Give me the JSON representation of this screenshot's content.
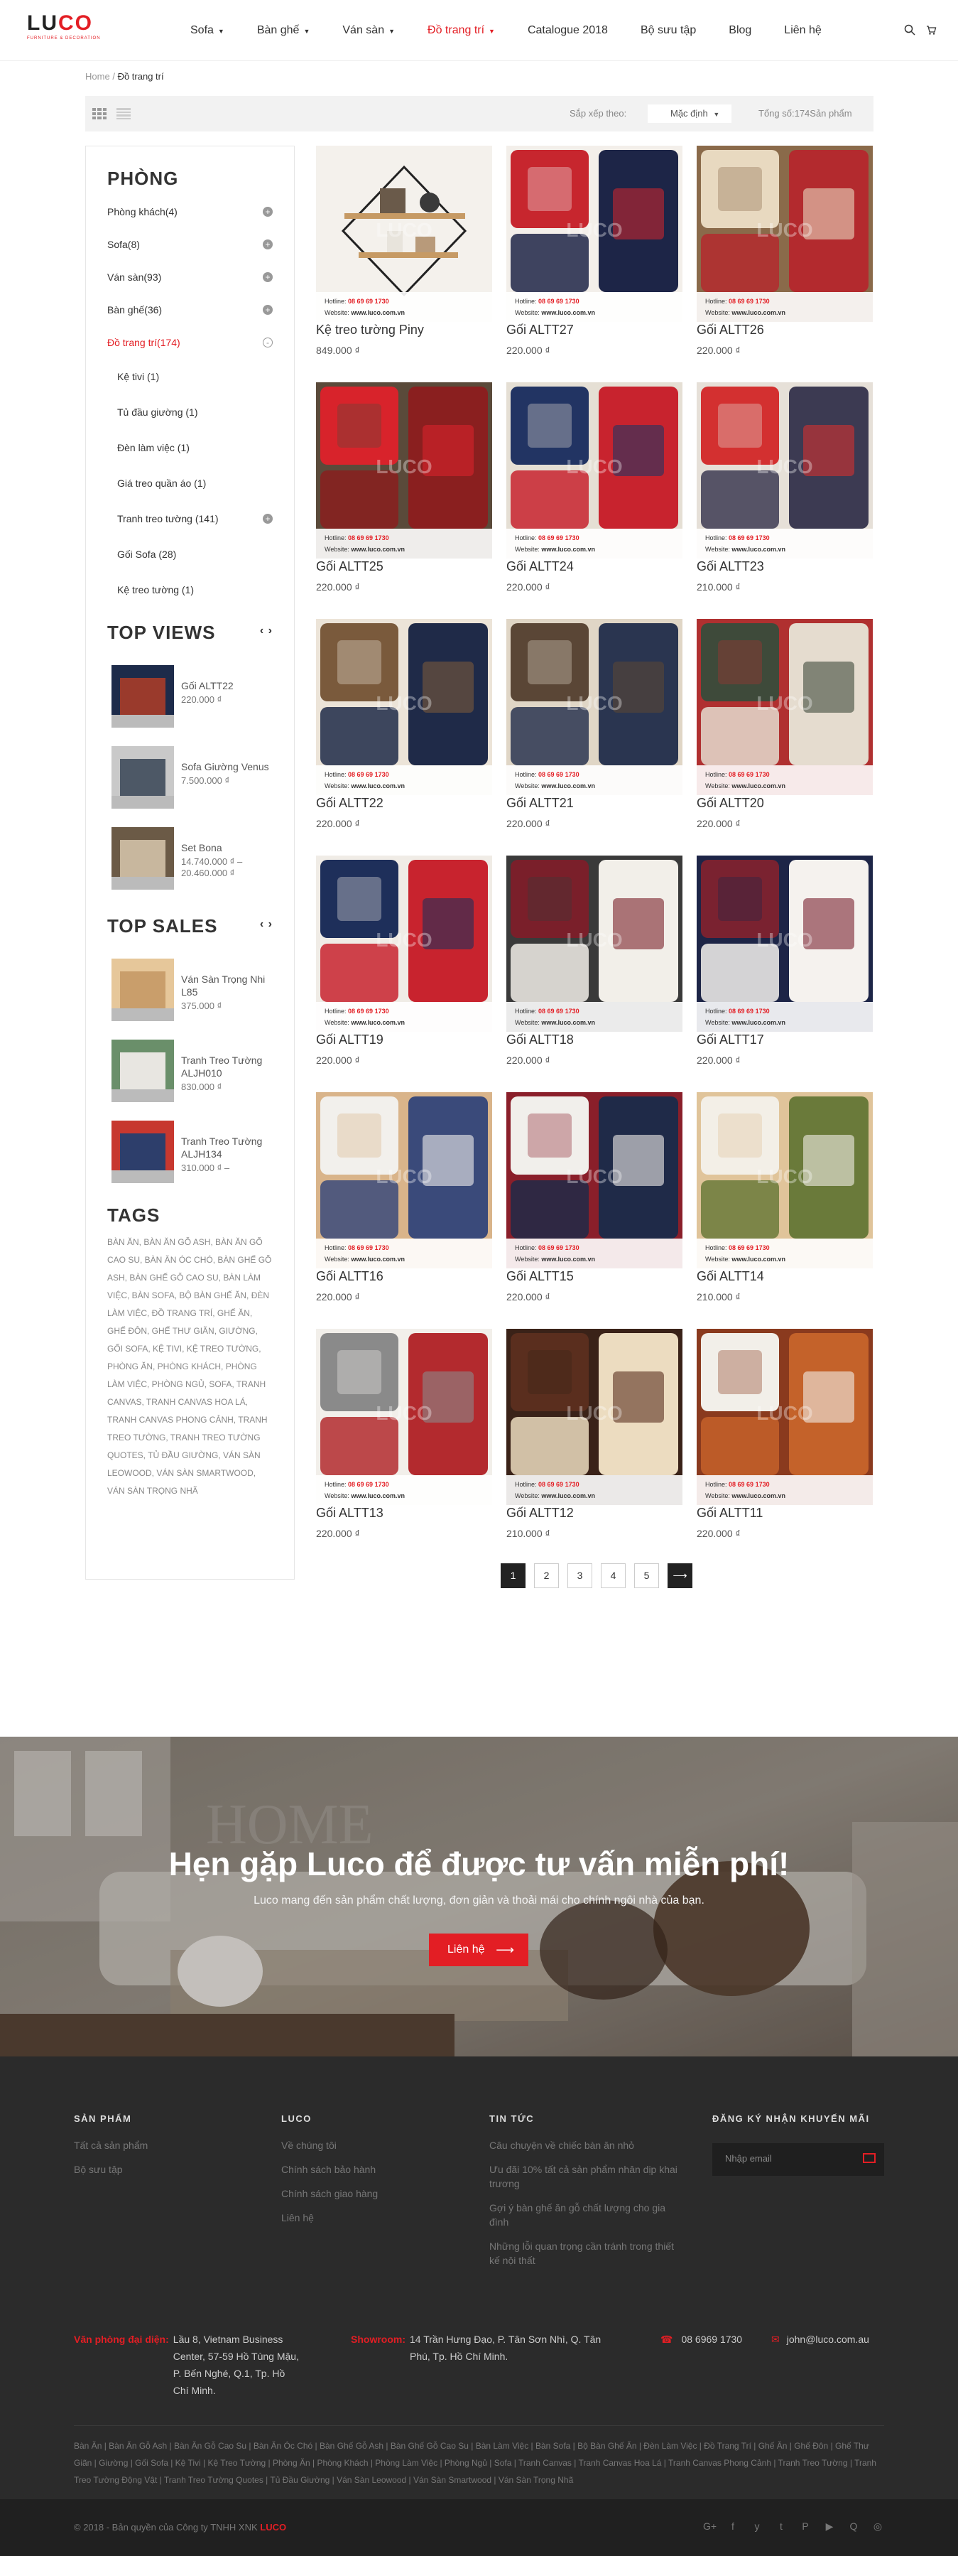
{
  "header": {
    "logo_main_1": "LU",
    "logo_main_2": "CO",
    "logo_sub": "FURNITURE & DECORATION",
    "nav": [
      {
        "label": "Sofa",
        "caret": true
      },
      {
        "label": "Bàn ghế",
        "caret": true
      },
      {
        "label": "Ván sàn",
        "caret": true
      },
      {
        "label": "Đồ trang trí",
        "caret": true,
        "active": true
      },
      {
        "label": "Catalogue 2018"
      },
      {
        "label": "Bộ sưu tập"
      },
      {
        "label": "Blog"
      },
      {
        "label": "Liên hệ"
      }
    ],
    "icons": [
      "search-icon",
      "cart-icon"
    ]
  },
  "breadcrumb": {
    "home": "Home",
    "sep": "/",
    "current": "Đồ trang trí"
  },
  "toolbar": {
    "sort_label": "Sắp xếp theo:",
    "sort_value": "Mặc định",
    "total": "Tổng số:174Sản phẩm"
  },
  "sidebar": {
    "title": "PHÒNG",
    "categories": [
      {
        "label": "Phòng khách(4)",
        "toggle": "+"
      },
      {
        "label": "Sofa(8)",
        "toggle": "+"
      },
      {
        "label": "Ván sàn(93)",
        "toggle": "+"
      },
      {
        "label": "Bàn ghế(36)",
        "toggle": "+"
      },
      {
        "label": "Đồ trang trí(174)",
        "toggle": "-",
        "active": true
      }
    ],
    "subcategories": [
      {
        "label": "Kệ tivi (1)"
      },
      {
        "label": "Tủ đầu giường (1)"
      },
      {
        "label": "Đèn làm việc (1)"
      },
      {
        "label": "Giá treo quần áo (1)"
      },
      {
        "label": "Tranh treo tường (141)",
        "toggle": "+"
      },
      {
        "label": "Gối Sofa (28)"
      },
      {
        "label": "Kệ treo tường (1)"
      }
    ],
    "top_views_title": "TOP VIEWS",
    "top_views": [
      {
        "name": "Gối ALTT22",
        "price": "220.000 ₫"
      },
      {
        "name": "Sofa Giường Venus",
        "price": "7.500.000 ₫"
      },
      {
        "name": "Set Bona",
        "price": "14.740.000 ₫ – 20.460.000 ₫"
      }
    ],
    "top_sales_title": "TOP SALES",
    "top_sales": [
      {
        "name": "Ván Sàn Trọng Nhi L85",
        "price": "375.000 ₫"
      },
      {
        "name": "Tranh Treo Tường ALJH010",
        "price": "830.000 ₫"
      },
      {
        "name": "Tranh Treo Tường ALJH134",
        "price": "310.000 ₫ –"
      }
    ],
    "tags_title": "TAGS",
    "tags_text": "BÀN ĂN, BÀN ĂN GỖ ASH, BÀN ĂN GỖ CAO SU, BÀN ĂN ÓC CHÓ, BÀN GHẾ GỖ ASH, BÀN GHẾ GỖ CAO SU, BÀN LÀM VIỆC, BÀN SOFA, BỘ BÀN GHẾ ĂN, ĐÈN LÀM VIỆC, ĐỒ TRANG TRÍ, GHẾ ĂN, GHẾ ĐÔN, GHẾ THƯ GIÃN, GIƯỜNG, GỐI SOFA, KỆ TIVI, KỆ TREO TƯỜNG, PHÒNG ĂN, PHÒNG KHÁCH, PHÒNG LÀM VIỆC, PHÒNG NGỦ, SOFA, TRANH CANVAS, TRANH CANVAS HOA LÁ, TRANH CANVAS PHONG CẢNH, TRANH TREO TƯỜNG, TRANH TREO TƯỜNG QUOTES, TỦ ĐẦU GIƯỜNG, VÁN SÀN LEOWOOD, VÁN SÀN SMARTWOOD, VÁN SÀN TRỌNG NHÃ"
  },
  "products": [
    {
      "name": "Kệ treo tường Piny",
      "price": "849.000 ₫",
      "style": "shelf"
    },
    {
      "name": "Gối ALTT27",
      "price": "220.000 ₫",
      "style": "red-navy"
    },
    {
      "name": "Gối ALTT26",
      "price": "220.000 ₫",
      "style": "cream-red"
    },
    {
      "name": "Gối ALTT25",
      "price": "220.000 ₫",
      "style": "red"
    },
    {
      "name": "Gối ALTT24",
      "price": "220.000 ₫",
      "style": "navy-red"
    },
    {
      "name": "Gối ALTT23",
      "price": "210.000 ₫",
      "style": "red2"
    },
    {
      "name": "Gối ALTT22",
      "price": "220.000 ₫",
      "style": "brown-navy"
    },
    {
      "name": "Gối ALTT21",
      "price": "220.000 ₫",
      "style": "brown-navy2"
    },
    {
      "name": "Gối ALTT20",
      "price": "220.000 ₫",
      "style": "green-cream"
    },
    {
      "name": "Gối ALTT19",
      "price": "220.000 ₫",
      "style": "stripes"
    },
    {
      "name": "Gối ALTT18",
      "price": "220.000 ₫",
      "style": "maroon-white"
    },
    {
      "name": "Gối ALTT17",
      "price": "220.000 ₫",
      "style": "letter"
    },
    {
      "name": "Gối ALTT16",
      "price": "220.000 ₫",
      "style": "white-bow"
    },
    {
      "name": "Gối ALTT15",
      "price": "220.000 ₫",
      "style": "white-navy"
    },
    {
      "name": "Gối ALTT14",
      "price": "210.000 ₫",
      "style": "white-flowers"
    },
    {
      "name": "Gối ALTT13",
      "price": "220.000 ₫",
      "style": "grey-flowers"
    },
    {
      "name": "Gối ALTT12",
      "price": "210.000 ₫",
      "style": "brown-cream"
    },
    {
      "name": "Gối ALTT11",
      "price": "220.000 ₫",
      "style": "white-orange"
    }
  ],
  "product_overlay": {
    "hotline_label": "Hotline:",
    "hotline": "08 69 69 1730",
    "web_label": "Website:",
    "web": "www.luco.com.vn",
    "watermark": "LUCO"
  },
  "pagination": {
    "pages": [
      "1",
      "2",
      "3",
      "4",
      "5"
    ],
    "current": "1",
    "next": "⟶"
  },
  "hero": {
    "bg_word": "HOME",
    "title": "Hẹn gặp Luco để được tư vấn miễn phí!",
    "subtitle": "Luco mang đến sản phẩm chất lượng, đơn giản và thoải mái cho chính ngôi nhà của bạn.",
    "button": "Liên hệ",
    "button_arrow": "⟶"
  },
  "footer": {
    "col1_title": "SẢN PHẨM",
    "col1_links": [
      "Tất cả sản phẩm",
      "Bộ sưu tập"
    ],
    "col2_title": "LUCO",
    "col2_links": [
      "Về chúng tôi",
      "Chính sách bảo hành",
      "Chính sách giao hàng",
      "Liên hệ"
    ],
    "col3_title": "TIN TỨC",
    "col3_links": [
      "Câu chuyện về chiếc bàn ăn nhỏ",
      "Ưu đãi 10% tất cả sản phẩm nhân dịp khai trương",
      "Gợi ý bàn ghế ăn gỗ chất lượng cho gia đình",
      "Những lỗi quan trọng cần tránh trong thiết kế nội thất"
    ],
    "col4_title": "ĐĂNG KÝ NHẬN KHUYẾN MÃI",
    "email_placeholder": "Nhập email",
    "office_label": "Văn phòng đại diện:",
    "office_addr": "Lầu 8, Vietnam Business Center, 57-59 Hồ Tùng Mậu, P. Bến Nghé, Q.1, Tp. Hồ Chí Minh.",
    "showroom_label": "Showroom:",
    "showroom_addr": "14 Trần Hưng Đạo, P. Tân Sơn Nhì, Q. Tân Phú, Tp. Hồ Chí Minh.",
    "phone": "08 6969 1730",
    "email": "john@luco.com.au",
    "links": "Bàn Ăn | Bàn Ăn Gỗ Ash | Bàn Ăn Gỗ Cao Su | Bàn Ăn Óc Chó | Bàn Ghế Gỗ Ash | Bàn Ghế Gỗ Cao Su | Bàn Làm Việc | Bàn Sofa | Bộ Bàn Ghế Ăn | Đèn Làm Việc | Đồ Trang Trí | Ghế Ăn | Ghế Đôn | Ghế Thư Giãn | Giường | Gối Sofa | Kệ Tivi | Kệ Treo Tường | Phòng Ăn | Phòng Khách | Phòng Làm Việc | Phòng Ngủ | Sofa | Tranh Canvas | Tranh Canvas Hoa Lá | Tranh Canvas Phong Cảnh | Tranh Treo Tường | Tranh Treo Tường Động Vật | Tranh Treo Tường Quotes | Tủ Đầu Giường | Ván Sàn Leowood | Ván Sàn Smartwood | Ván Sàn Trọng Nhã"
  },
  "copyright": {
    "text": "© 2018 - Bản quyền của Công ty TNHH XNK",
    "brand": "LUCO",
    "socials": [
      "G+",
      "f",
      "y",
      "t",
      "P",
      "▶",
      "Q",
      "◎"
    ]
  },
  "colors": {
    "accent": "#e31e24",
    "dark": "#2b2b2b"
  }
}
